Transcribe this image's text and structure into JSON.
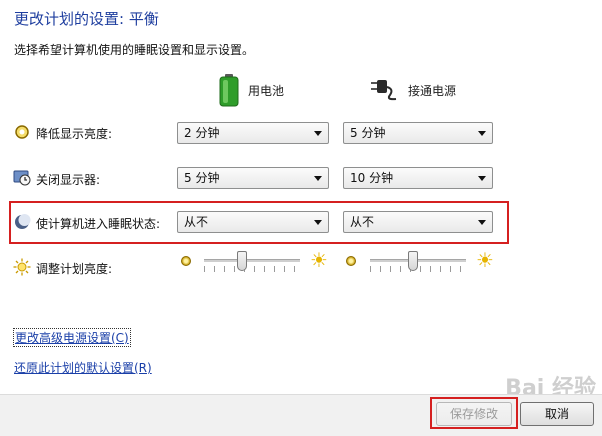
{
  "window": {
    "title": "更改计划的设置: 平衡",
    "subtitle": "选择希望计算机使用的睡眠设置和显示设置。"
  },
  "columns": {
    "battery": "用电池",
    "plugged": "接通电源"
  },
  "rows": [
    {
      "label": "降低显示亮度:",
      "battery": "2 分钟",
      "plugged": "5 分钟"
    },
    {
      "label": "关闭显示器:",
      "battery": "5 分钟",
      "plugged": "10 分钟"
    },
    {
      "label": "使计算机进入睡眠状态:",
      "battery": "从不",
      "plugged": "从不"
    }
  ],
  "brightness": {
    "label": "调整计划亮度:",
    "battery_level": 0.4,
    "plugged_level": 0.45
  },
  "links": {
    "advanced": "更改高级电源设置(C)",
    "restore": "还原此计划的默认设置(R)"
  },
  "buttons": {
    "save": "保存修改",
    "cancel": "取消"
  },
  "watermark": "Bai 经验",
  "colors": {
    "title": "#1e3e9f",
    "link": "#1a3fa8",
    "highlight": "#d52020"
  }
}
